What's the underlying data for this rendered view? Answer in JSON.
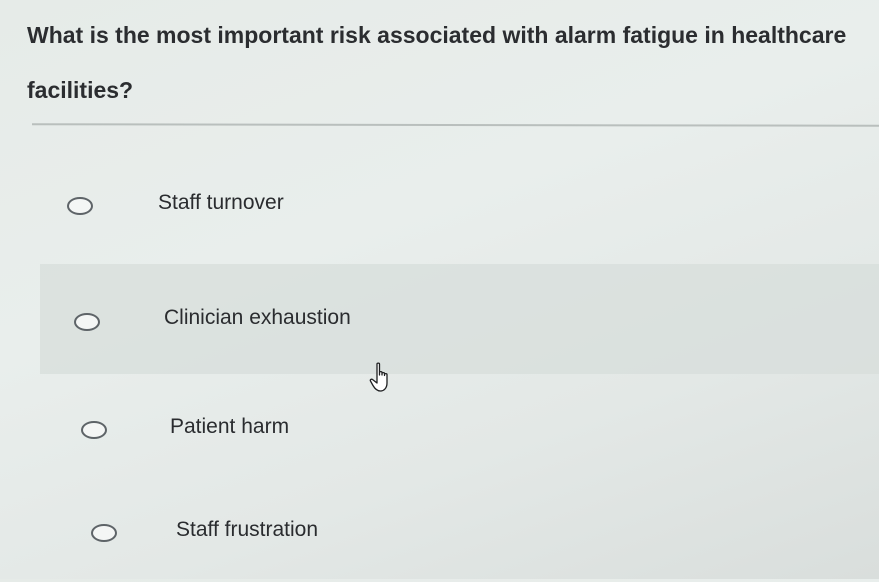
{
  "question": {
    "text": "What is the most important risk associated with alarm fatigue in healthcare facilities?"
  },
  "options": [
    {
      "label": "Staff turnover"
    },
    {
      "label": "Clinician exhaustion"
    },
    {
      "label": "Patient harm"
    },
    {
      "label": "Staff frustration"
    }
  ],
  "cursor": {
    "icon": "hand-pointer-icon"
  }
}
